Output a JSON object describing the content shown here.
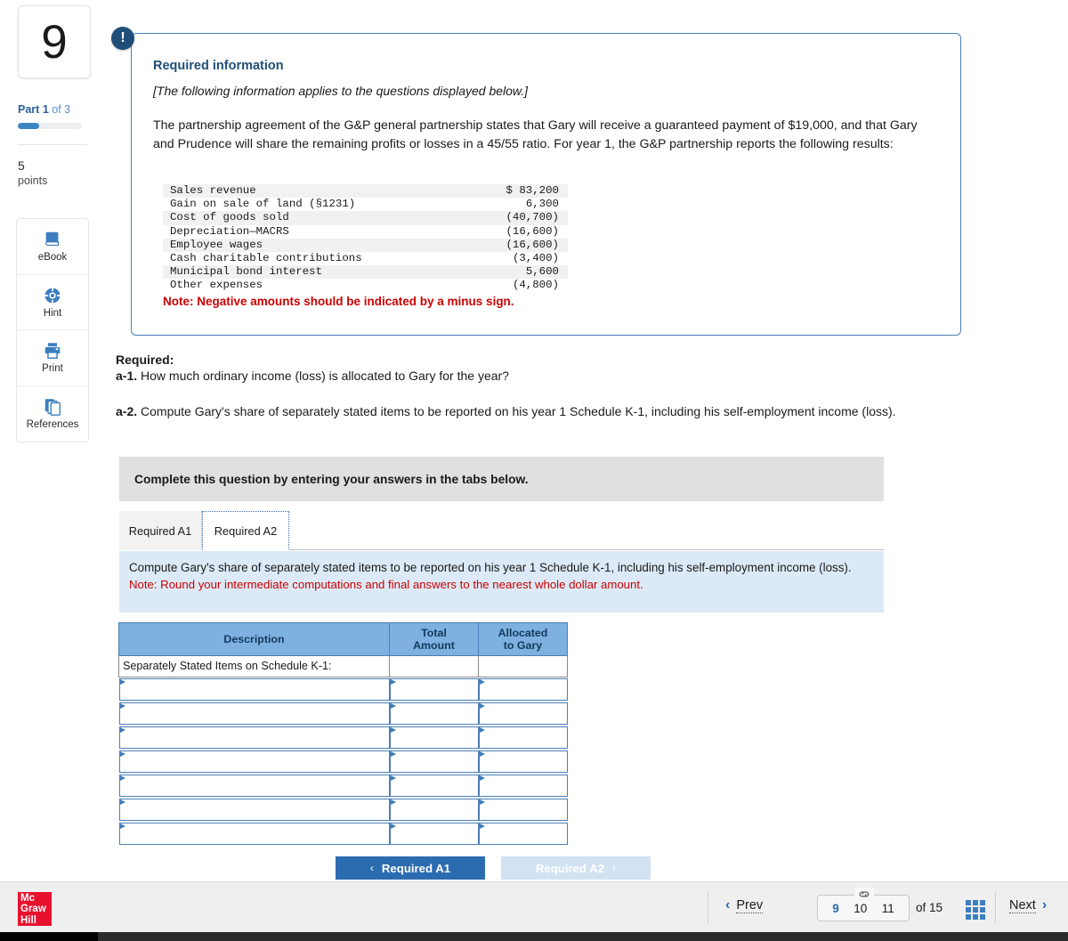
{
  "sidebar": {
    "question_number": "9",
    "part_label_prefix": "Part",
    "part_current": "1",
    "part_of": "of 3",
    "progress_percent": 33,
    "points_value": "5",
    "points_label": "points",
    "tools": [
      {
        "icon": "book-icon",
        "label": "eBook"
      },
      {
        "icon": "lifebuoy-icon",
        "label": "Hint"
      },
      {
        "icon": "printer-icon",
        "label": "Print"
      },
      {
        "icon": "pages-stack-icon",
        "label": "References"
      }
    ]
  },
  "required_info": {
    "badge_icon": "exclamation-icon",
    "title": "Required information",
    "applies_note": "[The following information applies to the questions displayed below.]",
    "paragraph": "The partnership agreement of the G&P general partnership states that Gary will receive a guaranteed payment of $19,000, and that Gary and Prudence will share the remaining profits or losses in a 45/55 ratio. For year 1, the G&P partnership reports the following results:",
    "financials": [
      {
        "label": "Sales revenue",
        "amount": "$ 83,200"
      },
      {
        "label": "Gain on sale of land (§1231)",
        "amount": "6,300"
      },
      {
        "label": "Cost of goods sold",
        "amount": "(40,700)"
      },
      {
        "label": "Depreciation—MACRS",
        "amount": "(16,600)"
      },
      {
        "label": "Employee wages",
        "amount": "(16,600)"
      },
      {
        "label": "Cash charitable contributions",
        "amount": "(3,400)"
      },
      {
        "label": "Municipal bond interest",
        "amount": "5,600"
      },
      {
        "label": "Other expenses",
        "amount": "(4,800)"
      }
    ],
    "negative_note": "Note: Negative amounts should be indicated by a minus sign."
  },
  "required_section": {
    "heading": "Required:",
    "a1_tag": "a-1.",
    "a1_text": " How much ordinary income (loss) is allocated to Gary for the year?",
    "a2_tag": "a-2.",
    "a2_text": " Compute Gary's share of separately stated items to be reported on his year 1 Schedule K-1, including his self-employment income (loss)."
  },
  "instruction_bar": {
    "text": "Complete this question by entering your answers in the tabs below."
  },
  "tabs": [
    {
      "label": "Required A1",
      "active": false
    },
    {
      "label": "Required A2",
      "active": true
    }
  ],
  "blue_panel": {
    "prompt": "Compute Gary's share of separately stated items to be reported on his year 1 Schedule K-1, including his self-employment income (loss).",
    "note": "Note: Round your intermediate computations and final answers to the nearest whole dollar amount."
  },
  "answer_table": {
    "headers": [
      "Description",
      "Total\nAmount",
      "Allocated\nto Gary"
    ],
    "header_description": "Description",
    "header_total_l1": "Total",
    "header_total_l2": "Amount",
    "header_alloc_l1": "Allocated",
    "header_alloc_l2": "to Gary",
    "section_label": "Separately Stated Items on Schedule K-1:",
    "rows": [
      {
        "description": "",
        "total_amount": "",
        "allocated": ""
      },
      {
        "description": "",
        "total_amount": "",
        "allocated": ""
      },
      {
        "description": "",
        "total_amount": "",
        "allocated": ""
      },
      {
        "description": "",
        "total_amount": "",
        "allocated": ""
      },
      {
        "description": "",
        "total_amount": "",
        "allocated": ""
      },
      {
        "description": "",
        "total_amount": "",
        "allocated": ""
      },
      {
        "description": "",
        "total_amount": "",
        "allocated": ""
      }
    ]
  },
  "nav_buttons": {
    "prev_label": "Required A1",
    "prev_chevron": "‹",
    "next_label": "Required A2",
    "next_chevron": "›"
  },
  "footer": {
    "logo_line1": "Mc",
    "logo_line2": "Graw",
    "logo_line3": "Hill",
    "logo_color": "#e8112d",
    "prev_label": "Prev",
    "prev_chevron": "‹",
    "pages": [
      {
        "number": "9",
        "active": true
      },
      {
        "number": "10",
        "active": false
      },
      {
        "number": "11",
        "active": false
      }
    ],
    "link_icon": "chain-link-icon",
    "of_text": "of 15",
    "grid_icon": "grid-menu-icon",
    "next_label": "Next",
    "next_chevron": "›"
  },
  "colors": {
    "accent_blue": "#2b6cb0",
    "panel_border": "#4a7fb5",
    "table_header": "#7eb0e0",
    "note_red": "#cc0000",
    "brand_red": "#e8112d"
  }
}
